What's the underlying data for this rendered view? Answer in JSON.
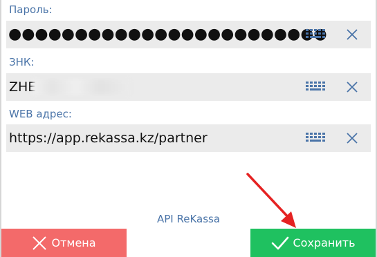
{
  "fields": [
    {
      "label": "Пароль:",
      "value": "●●●●●●●●●●●●●●●●●●●●●●●●",
      "masked": true
    },
    {
      "label": "ЗНК:",
      "value": "ZHE",
      "blurred_suffix": true
    },
    {
      "label": "WEB адрес:",
      "value": "https://app.rekassa.kz/partner"
    }
  ],
  "footer": {
    "text": "API ReKassa"
  },
  "buttons": {
    "cancel_label": "Отмена",
    "save_label": "Сохранить"
  },
  "icons": {
    "keyboard": "keyboard-icon",
    "clear": "close-icon",
    "cancel": "close-icon",
    "save": "checkmark-icon",
    "annotation": "arrow-icon"
  },
  "colors": {
    "label": "#4a74a8",
    "field_bg": "#ebebeb",
    "cancel": "#f36a6a",
    "save": "#1fc160",
    "arrow": "#e52222"
  }
}
